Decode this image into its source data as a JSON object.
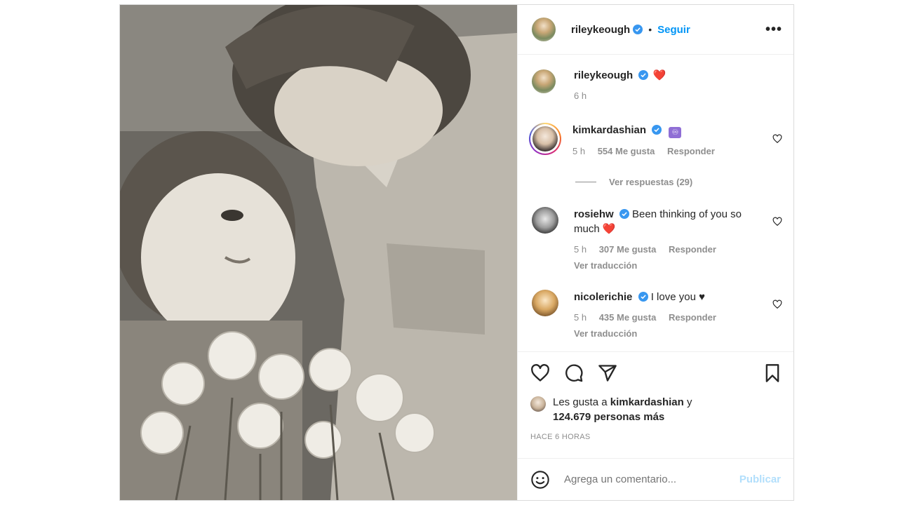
{
  "post": {
    "author": "rileykeough",
    "follow_label": "Seguir",
    "more_label": "•••"
  },
  "caption": {
    "username": "rileykeough",
    "text": "❤️",
    "time": "6 h"
  },
  "comments": [
    {
      "username": "kimkardashian",
      "badge": "♾",
      "text": "",
      "time": "5 h",
      "likes": "554 Me gusta",
      "reply": "Responder",
      "view_replies": "Ver respuestas (29)"
    },
    {
      "username": "rosiehw",
      "text": "Been thinking of you so much ❤️",
      "time": "5 h",
      "likes": "307 Me gusta",
      "reply": "Responder",
      "translate": "Ver traducción"
    },
    {
      "username": "nicolerichie",
      "text": "I love you ♥",
      "time": "5 h",
      "likes": "435 Me gusta",
      "reply": "Responder",
      "translate": "Ver traducción"
    }
  ],
  "likes": {
    "prefix": "Les gusta a",
    "user": "kimkardashian",
    "joiner": "y",
    "others": "124.679 personas más"
  },
  "posted_ago": "HACE 6 HORAS",
  "composer": {
    "placeholder": "Agrega un comentario...",
    "publish_label": "Publicar"
  },
  "colors": {
    "link_blue": "#0095f6",
    "publish_disabled": "#b2dffc",
    "heart_red": "#ed4956",
    "verified_blue": "#3897f0"
  },
  "icons": [
    "like-icon",
    "comment-icon",
    "share-icon",
    "save-icon",
    "emoji-icon",
    "more-icon",
    "verified-icon"
  ]
}
